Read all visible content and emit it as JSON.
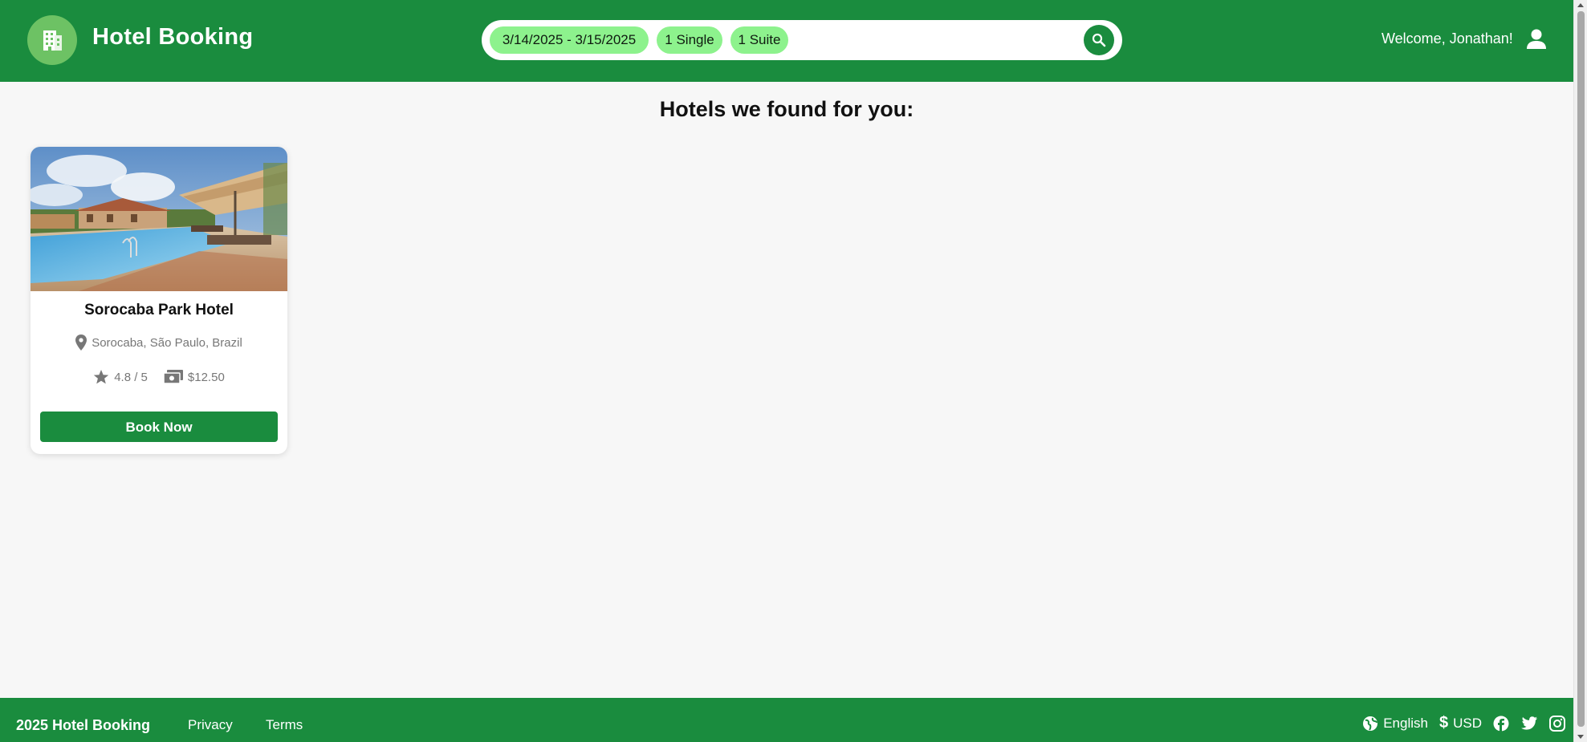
{
  "header": {
    "app_title": "Hotel Booking",
    "logo_icon": "hotel-building-icon",
    "welcome_text": "Welcome, Jonathan!",
    "user_icon": "user-icon",
    "colors": {
      "brand_green": "#1a8c3e",
      "chip_green": "#8df28d",
      "logo_bg": "#6dc264"
    }
  },
  "search": {
    "dates": "3/14/2025 - 3/15/2025",
    "room_single": "1 Single",
    "room_suite": "1 Suite",
    "search_icon": "search-icon"
  },
  "main": {
    "results_title": "Hotels we found for you:",
    "hotels": [
      {
        "name": "Sorocaba Park Hotel",
        "location": "Sorocaba, São Paulo, Brazil",
        "rating": "4.8 / 5",
        "price": "$12.50",
        "book_label": "Book Now",
        "image": "hotel-pool-photo"
      }
    ]
  },
  "footer": {
    "brand": "2025 Hotel Booking",
    "privacy": "Privacy",
    "terms": "Terms",
    "language": "English",
    "currency": "USD",
    "social_icons": [
      "facebook-icon",
      "twitter-icon",
      "instagram-icon"
    ]
  }
}
